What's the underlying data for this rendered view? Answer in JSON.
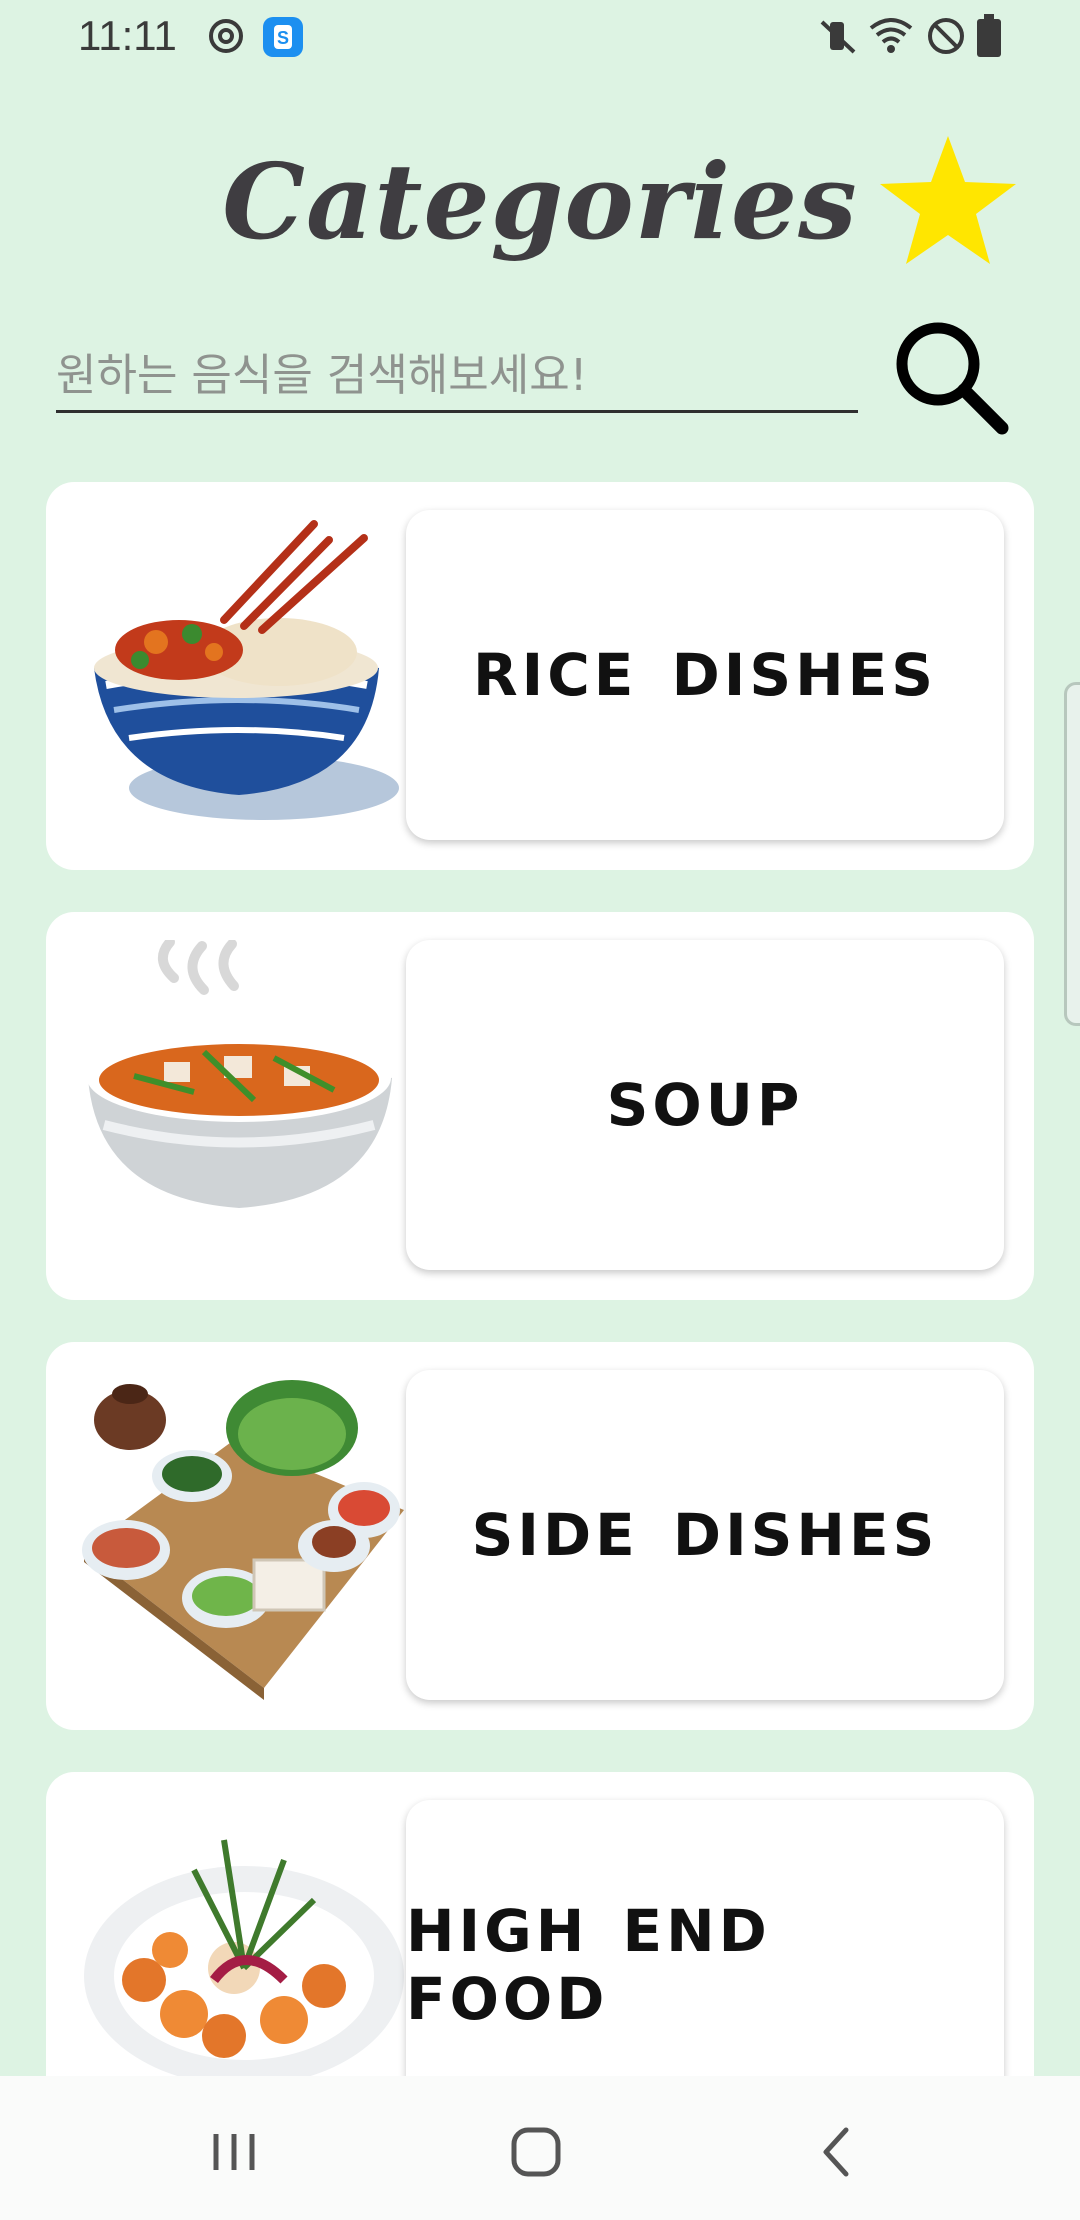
{
  "status_bar": {
    "time": "11:11",
    "left_icons": [
      "sync-icon",
      "s-app-icon"
    ],
    "right_icons": [
      "mute-vibrate-icon",
      "wifi-icon",
      "do-not-disturb-icon",
      "battery-icon"
    ]
  },
  "header": {
    "title": "Categories",
    "favorite_icon": "star-icon",
    "star_color": "#ffe600"
  },
  "search": {
    "placeholder": "원하는 음식을 검색해보세요!",
    "value": "",
    "button_icon": "magnifier-icon"
  },
  "categories": [
    {
      "label": "RICE DISHES",
      "image": "rice-bowl-image"
    },
    {
      "label": "SOUP",
      "image": "soup-bowl-image"
    },
    {
      "label": "SIDE DISHES",
      "image": "side-dishes-tray-image"
    },
    {
      "label": "HIGH END FOOD",
      "image": "shrimp-platter-image"
    }
  ],
  "nav_bar": {
    "buttons": [
      "recent-apps-icon",
      "home-icon",
      "back-icon"
    ]
  },
  "colors": {
    "background": "#ddf3e3",
    "card": "#ffffff",
    "text": "#111111",
    "title": "#3f3d41"
  }
}
